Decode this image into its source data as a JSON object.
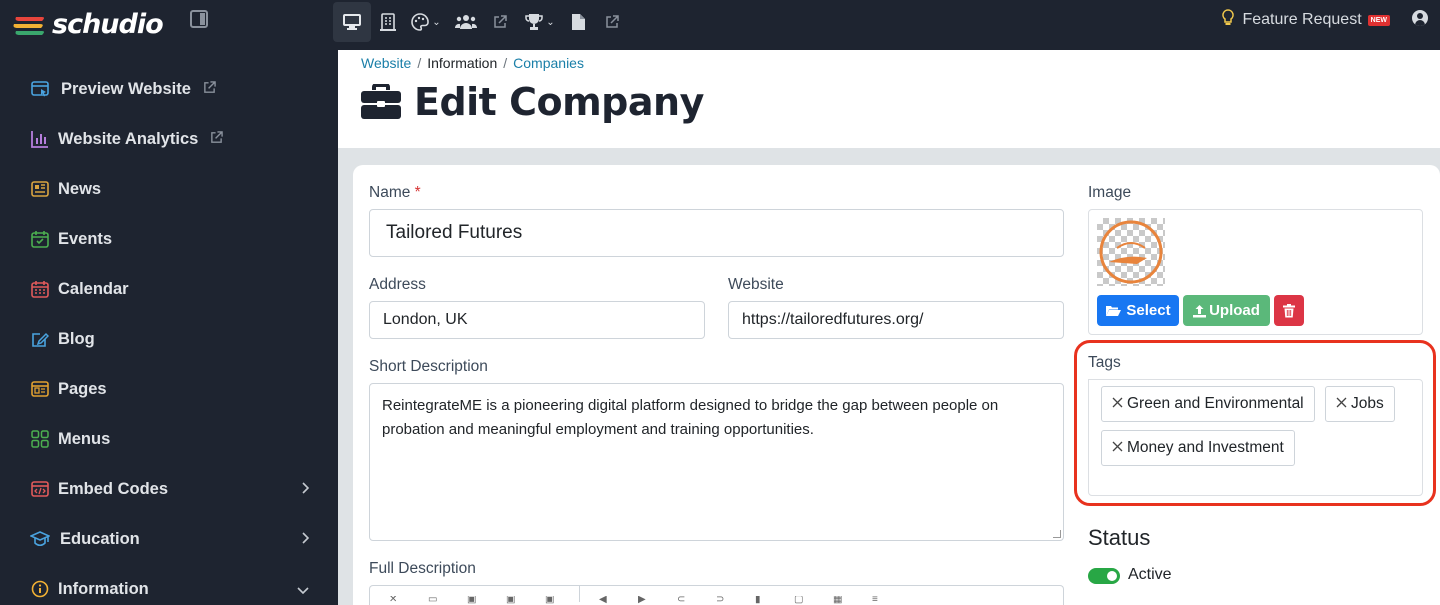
{
  "app": {
    "logo_text": "schudio",
    "feature_request": "Feature Request",
    "new_badge": "NEW"
  },
  "topnav": {
    "icons": [
      "desktop-icon",
      "building-icon",
      "palette-icon",
      "users-icon",
      "external-link-icon",
      "trophy-icon",
      "document-icon",
      "external-link-icon"
    ]
  },
  "sidebar": {
    "items": [
      {
        "label": "Preview Website",
        "icon": "preview-icon",
        "color": "#4aa3df"
      },
      {
        "label": "Website Analytics",
        "icon": "analytics-icon",
        "color": "#b57edc"
      },
      {
        "label": "News",
        "icon": "news-icon",
        "color": "#d9a441"
      },
      {
        "label": "Events",
        "icon": "events-icon",
        "color": "#4caf50"
      },
      {
        "label": "Calendar",
        "icon": "calendar-icon",
        "color": "#e05a5a"
      },
      {
        "label": "Blog",
        "icon": "blog-icon",
        "color": "#4aa3df"
      },
      {
        "label": "Pages",
        "icon": "pages-icon",
        "color": "#e0a030"
      },
      {
        "label": "Menus",
        "icon": "menus-icon",
        "color": "#4caf50"
      },
      {
        "label": "Embed Codes",
        "icon": "embed-icon",
        "color": "#e05a5a"
      },
      {
        "label": "Education",
        "icon": "education-icon",
        "color": "#4aa3df"
      },
      {
        "label": "Information",
        "icon": "information-icon",
        "color": "#f2b134"
      }
    ]
  },
  "breadcrumb": {
    "website": "Website",
    "sep": "/",
    "information": "Information",
    "companies": "Companies"
  },
  "page": {
    "title": "Edit Company"
  },
  "form": {
    "name_label": "Name",
    "required_mark": "*",
    "name_value": "Tailored Futures",
    "address_label": "Address",
    "address_value": "London, UK",
    "website_label": "Website",
    "website_value": "https://tailoredfutures.org/",
    "short_desc_label": "Short Description",
    "short_desc_value": "ReintegrateME is a pioneering digital platform designed to bridge the gap between people on probation and meaningful employment and training opportunities.",
    "full_desc_label": "Full Description"
  },
  "image": {
    "label": "Image",
    "select_label": "Select",
    "upload_label": "Upload"
  },
  "tags": {
    "label": "Tags",
    "items": [
      "Green and Environmental",
      "Jobs",
      "Money and Investment"
    ]
  },
  "status": {
    "heading": "Status",
    "toggle_label": "Active",
    "active": true
  }
}
